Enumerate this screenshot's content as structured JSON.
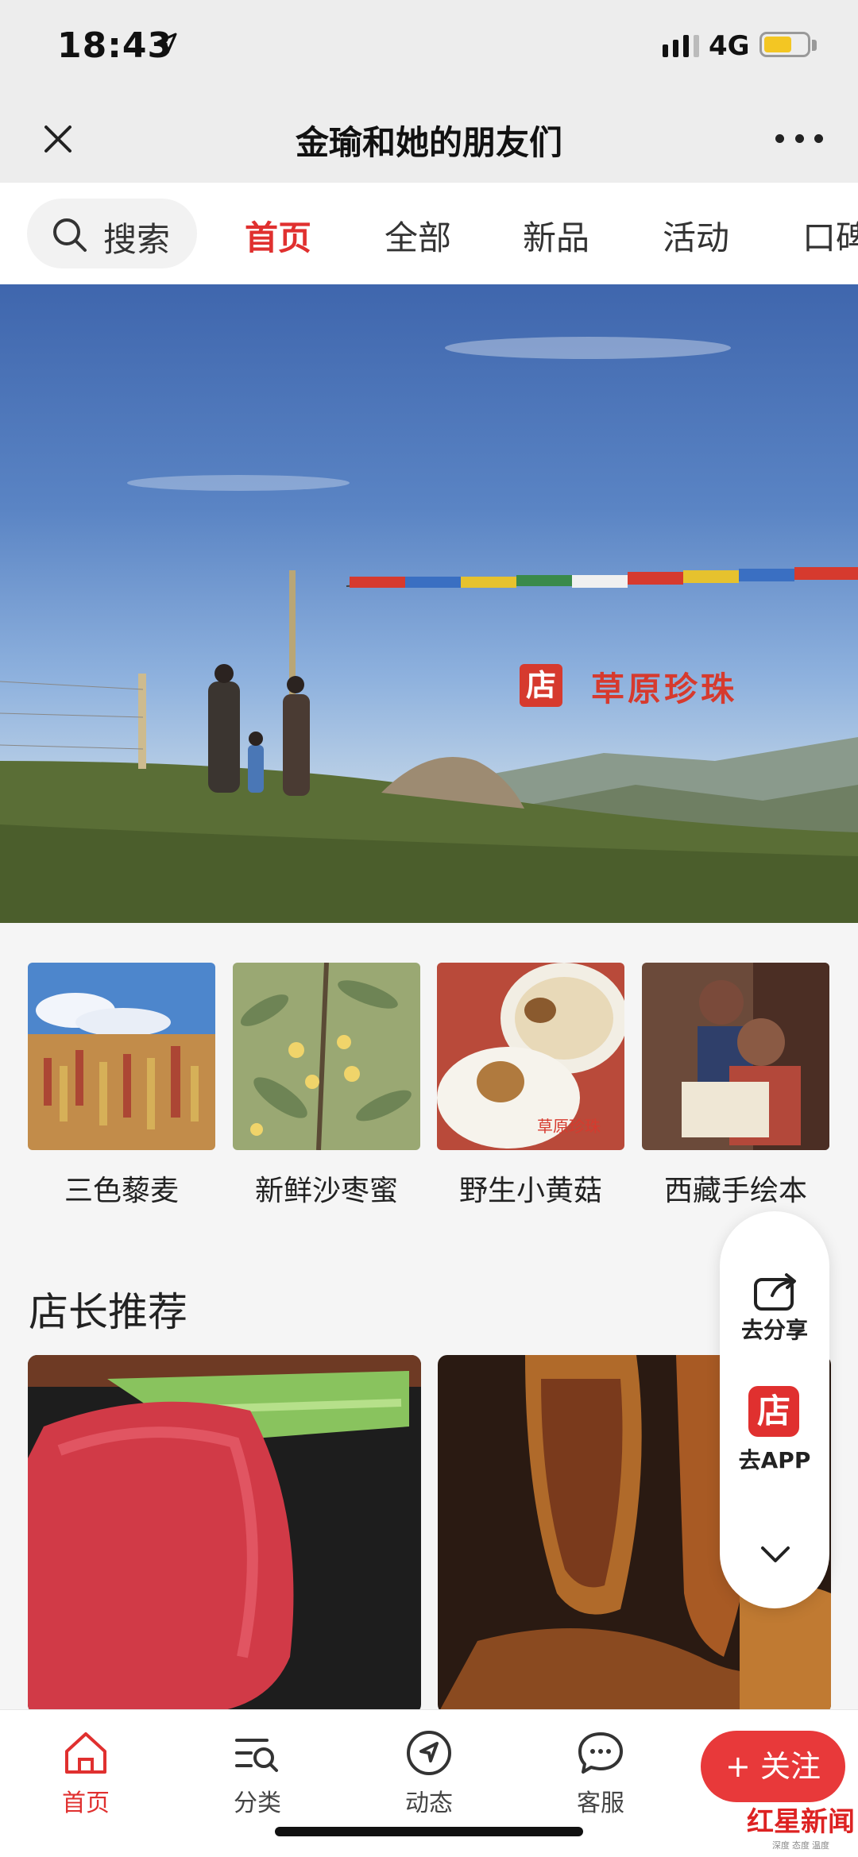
{
  "status_bar": {
    "time": "18:43",
    "network": "4G",
    "battery_level": 0.58
  },
  "header": {
    "title": "金瑜和她的朋友们"
  },
  "nav": {
    "search_label": "搜索",
    "tabs": [
      {
        "label": "首页",
        "active": true
      },
      {
        "label": "全部",
        "active": false
      },
      {
        "label": "新品",
        "active": false
      },
      {
        "label": "活动",
        "active": false
      },
      {
        "label": "口碑",
        "active": false
      }
    ]
  },
  "banner": {
    "logo_char": "店",
    "brand_text": "草原珍珠"
  },
  "categories": [
    {
      "label": "三色藜麦"
    },
    {
      "label": "新鲜沙枣蜜"
    },
    {
      "label": "野生小黄菇",
      "overlay_text": "草原珍珠"
    },
    {
      "label": "西藏手绘本"
    }
  ],
  "section": {
    "title": "店长推荐"
  },
  "float_panel": {
    "share_label": "去分享",
    "app_icon_char": "店",
    "app_label": "去APP"
  },
  "bottom_nav": {
    "items": [
      {
        "label": "首页",
        "icon": "home-icon",
        "active": true
      },
      {
        "label": "分类",
        "icon": "category-icon",
        "active": false
      },
      {
        "label": "动态",
        "icon": "compass-icon",
        "active": false
      },
      {
        "label": "客服",
        "icon": "chat-icon",
        "active": false
      }
    ],
    "follow_label": "+ 关注"
  },
  "watermark": {
    "text": "红星新闻",
    "sub": "深度 态度 温度"
  },
  "colors": {
    "accent": "#e0302f",
    "background": "#f5f5f5"
  }
}
